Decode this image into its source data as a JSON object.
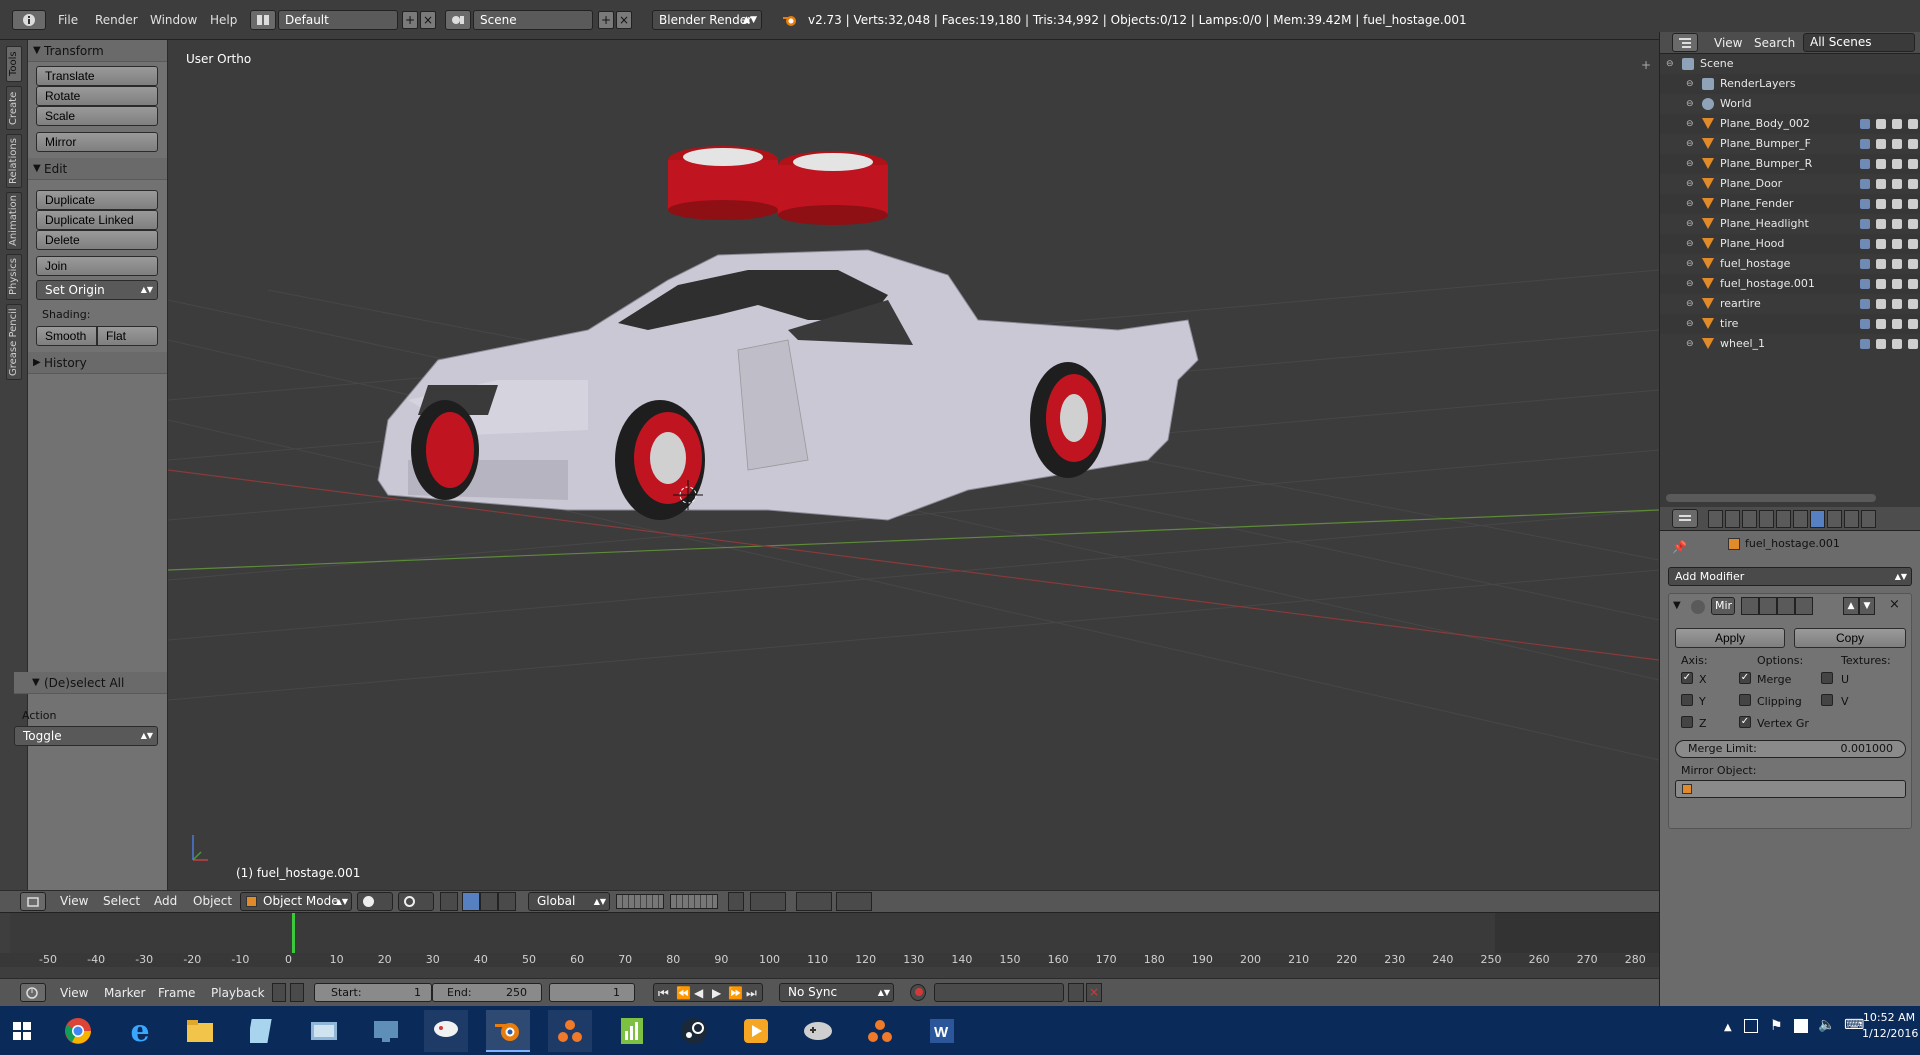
{
  "topbar": {
    "menus": [
      "File",
      "Render",
      "Window",
      "Help"
    ],
    "layout_value": "Default",
    "scene_value": "Scene",
    "render_engine": "Blender Render",
    "stats": "v2.73 | Verts:32,048 | Faces:19,180 | Tris:34,992 | Objects:0/12 | Lamps:0/0 | Mem:39.42M | fuel_hostage.001"
  },
  "left_tabs": [
    "Tools",
    "Create",
    "Relations",
    "Animation",
    "Physics",
    "Grease Pencil"
  ],
  "toolshelf": {
    "transform_header": "Transform",
    "translate": "Translate",
    "rotate": "Rotate",
    "scale": "Scale",
    "mirror": "Mirror",
    "edit_header": "Edit",
    "duplicate": "Duplicate",
    "duplicate_linked": "Duplicate Linked",
    "delete": "Delete",
    "join": "Join",
    "set_origin": "Set Origin",
    "shading_label": "Shading:",
    "smooth": "Smooth",
    "flat": "Flat",
    "history_header": "History",
    "deselect_header": "(De)select All",
    "action_label": "Action",
    "action_value": "Toggle"
  },
  "viewport": {
    "view_label": "User Ortho",
    "object_label": "(1) fuel_hostage.001"
  },
  "viewport_header": {
    "menus": [
      "View",
      "Select",
      "Add",
      "Object"
    ],
    "mode": "Object Mode",
    "orientation": "Global"
  },
  "timeline": {
    "numbers": [
      "-50",
      "-40",
      "-30",
      "-20",
      "-10",
      "0",
      "10",
      "20",
      "30",
      "40",
      "50",
      "60",
      "70",
      "80",
      "90",
      "100",
      "110",
      "120",
      "130",
      "140",
      "150",
      "160",
      "170",
      "180",
      "190",
      "200",
      "210",
      "220",
      "230",
      "240",
      "250",
      "260",
      "270",
      "280"
    ],
    "footer_menus": [
      "View",
      "Marker",
      "Frame",
      "Playback"
    ],
    "start_label": "Start:",
    "start_value": "1",
    "end_label": "End:",
    "end_value": "250",
    "current_frame": "1",
    "sync": "No Sync"
  },
  "outliner": {
    "header_menus": [
      "View",
      "Search"
    ],
    "scope": "All Scenes",
    "items": [
      {
        "name": "Scene",
        "indent": 0
      },
      {
        "name": "RenderLayers",
        "indent": 1
      },
      {
        "name": "World",
        "indent": 1
      },
      {
        "name": "Plane_Body_002",
        "indent": 1
      },
      {
        "name": "Plane_Bumper_F",
        "indent": 1
      },
      {
        "name": "Plane_Bumper_R",
        "indent": 1
      },
      {
        "name": "Plane_Door",
        "indent": 1
      },
      {
        "name": "Plane_Fender",
        "indent": 1
      },
      {
        "name": "Plane_Headlight",
        "indent": 1
      },
      {
        "name": "Plane_Hood",
        "indent": 1
      },
      {
        "name": "fuel_hostage",
        "indent": 1
      },
      {
        "name": "fuel_hostage.001",
        "indent": 1
      },
      {
        "name": "reartire",
        "indent": 1
      },
      {
        "name": "tire",
        "indent": 1
      },
      {
        "name": "wheel_1",
        "indent": 1
      }
    ]
  },
  "properties": {
    "object_name": "fuel_hostage.001",
    "add_modifier": "Add Modifier",
    "modifier_name": "Mir",
    "apply": "Apply",
    "copy": "Copy",
    "axis_label": "Axis:",
    "options_label": "Options:",
    "textures_label": "Textures:",
    "axis_x": "X",
    "axis_y": "Y",
    "axis_z": "Z",
    "merge": "Merge",
    "clipping": "Clipping",
    "vertex_gr": "Vertex Gr",
    "tex_u": "U",
    "tex_v": "V",
    "merge_limit_label": "Merge Limit:",
    "merge_limit_value": "0.001000",
    "mirror_object_label": "Mirror Object:"
  },
  "taskbar": {
    "time": "10:52 AM",
    "date": "1/12/2016"
  },
  "colors": {
    "accent_orange": "#e87d0d",
    "red_rim": "#c01520",
    "car_body": "#c9c8d4"
  }
}
